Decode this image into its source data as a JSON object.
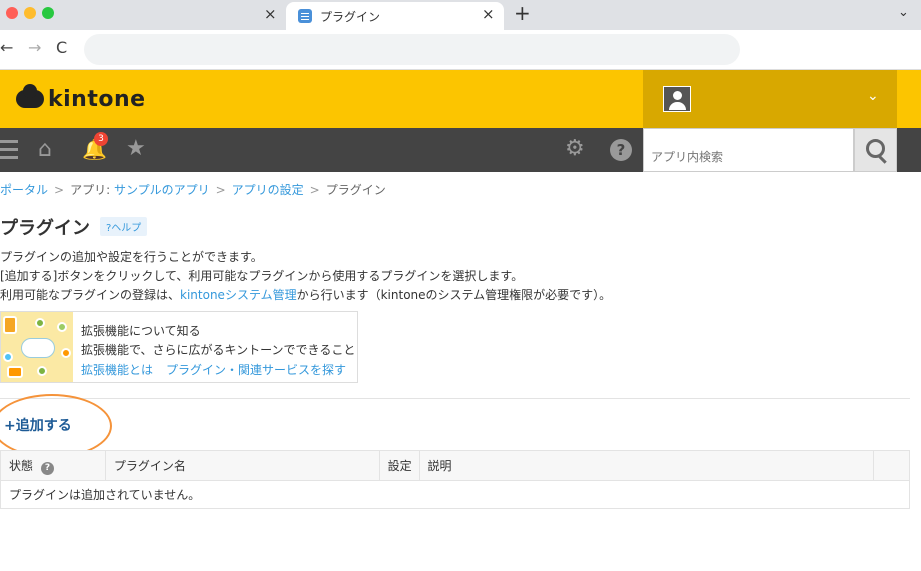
{
  "browser": {
    "tab_title": "プラグイン",
    "close_glyph": "×",
    "new_tab_glyph": "+",
    "menu_glyph": "⌄",
    "back_glyph": "←",
    "forward_glyph": "→",
    "reload_glyph": "C"
  },
  "header": {
    "logo_text": "kintone",
    "user_chevron": "⌄"
  },
  "nav": {
    "notification_count": "3",
    "search_placeholder": "アプリ内検索",
    "help_glyph": "?"
  },
  "breadcrumb": {
    "portal": "ポータル",
    "app_prefix": "アプリ: ",
    "app_name": "サンプルのアプリ",
    "app_settings": "アプリの設定",
    "current": "プラグイン",
    "separator": ">"
  },
  "page": {
    "title": "プラグイン",
    "help_label": "?ヘルプ",
    "desc_line1": "プラグインの追加や設定を行うことができます。",
    "desc_line2": "[追加する]ボタンをクリックして、利用可能なプラグインから使用するプラグインを選択します。",
    "desc_line3_prefix": "利用可能なプラグインの登録は、",
    "desc_line3_link": "kintoneシステム管理",
    "desc_line3_suffix": "から行います（kintoneのシステム管理権限が必要です）。"
  },
  "extension": {
    "title": "拡張機能について知る",
    "subtitle": "拡張機能で、さらに広がるキントーンでできること",
    "link1": "拡張機能とは",
    "link2": "プラグイン・関連サービスを探す"
  },
  "add_button": {
    "icon": "+",
    "label": "追加する"
  },
  "table": {
    "headers": [
      "状態",
      "プラグイン名",
      "設定",
      "説明"
    ],
    "status_help": "?",
    "empty_message": "プラグインは追加されていません。"
  }
}
